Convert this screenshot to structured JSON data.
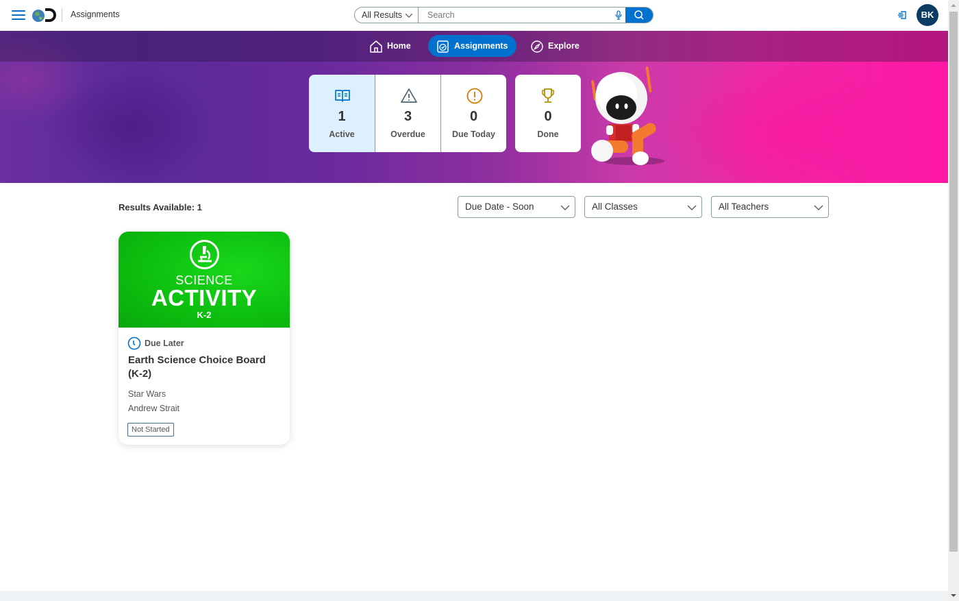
{
  "header": {
    "app_title": "Assignments",
    "search": {
      "scope": "All Results",
      "placeholder": "Search",
      "value": ""
    },
    "user_initials": "BK"
  },
  "nav": {
    "items": [
      {
        "label": "Home",
        "icon": "home-icon",
        "active": false
      },
      {
        "label": "Assignments",
        "icon": "assignment-check-icon",
        "active": true
      },
      {
        "label": "Explore",
        "icon": "compass-icon",
        "active": false
      }
    ]
  },
  "stats": {
    "items": [
      {
        "count": "1",
        "label": "Active",
        "icon": "open-book-icon",
        "color": "#0071ce",
        "selected": true
      },
      {
        "count": "3",
        "label": "Overdue",
        "icon": "warning-triangle-icon",
        "color": "#4a6470",
        "selected": false
      },
      {
        "count": "0",
        "label": "Due Today",
        "icon": "exclamation-circle-icon",
        "color": "#d97706",
        "selected": false
      }
    ],
    "done": {
      "count": "0",
      "label": "Done",
      "icon": "trophy-icon",
      "color": "#b08d00"
    }
  },
  "results": {
    "label": "Results Available: 1"
  },
  "filters": {
    "sort": "Due Date - Soon",
    "classes": "All Classes",
    "teachers": "All Teachers"
  },
  "cards": [
    {
      "thumb_line1": "SCIENCE",
      "thumb_line2": "ACTIVITY",
      "thumb_line3": "K-2",
      "due_status": "Due Later",
      "title": "Earth Science Choice Board (K-2)",
      "class_name": "Star Wars",
      "teacher": "Andrew Strait",
      "status": "Not Started"
    }
  ],
  "colors": {
    "accent": "#0071ce",
    "avatar": "#0b3a63",
    "thumb_green": "#0cbd0f"
  }
}
